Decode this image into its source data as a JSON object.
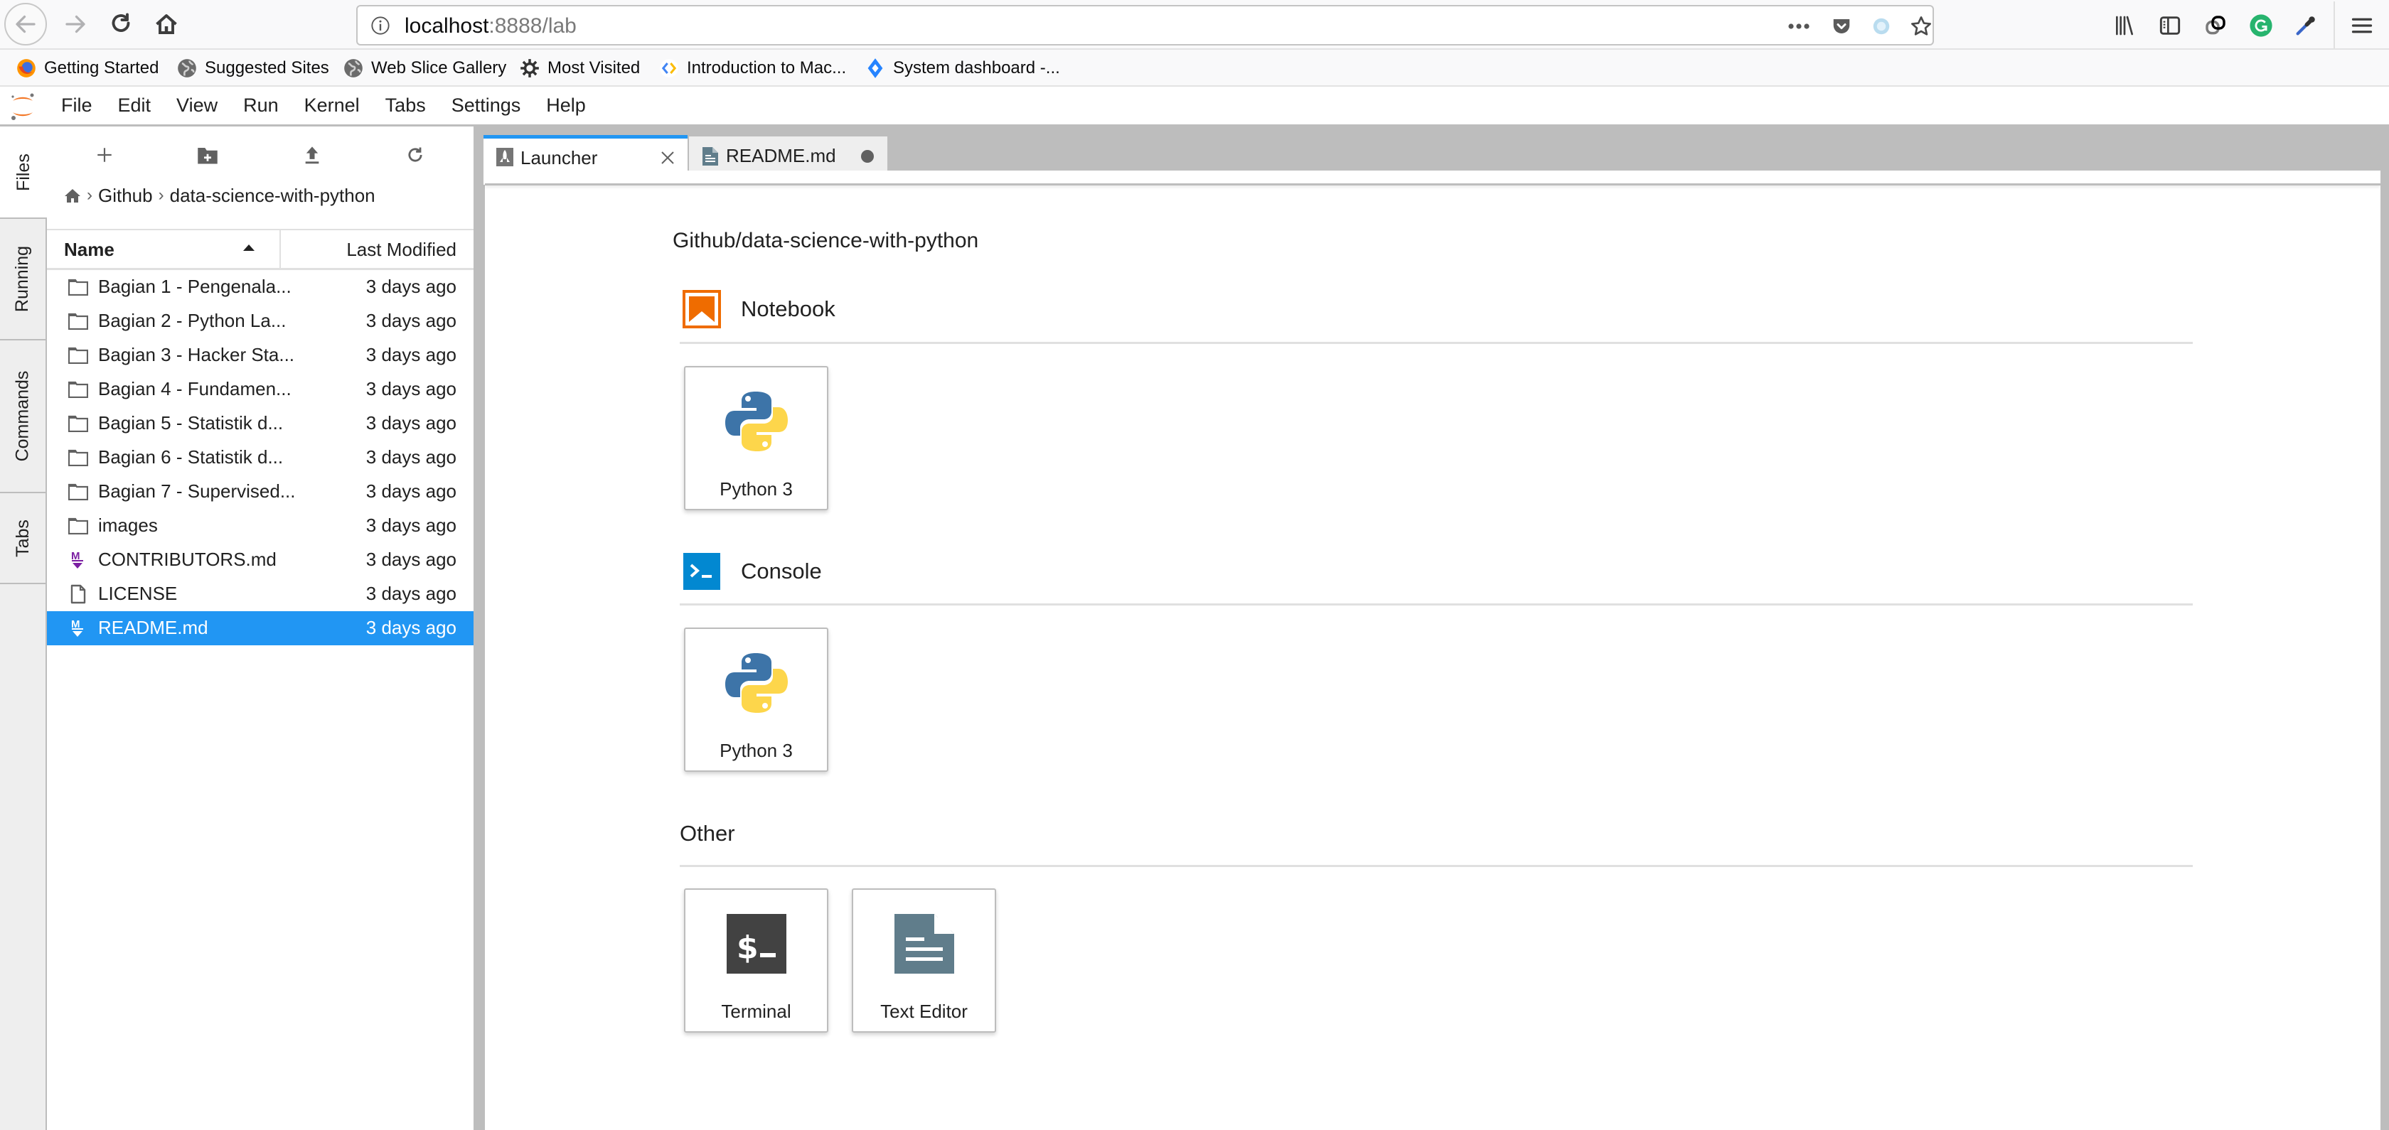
{
  "browser": {
    "url_host": "localhost",
    "url_rest": ":8888/lab",
    "nav": {
      "back": "back-icon",
      "forward": "forward-icon",
      "reload": "reload-icon",
      "home": "home-icon"
    },
    "url_icons": [
      "page-actions-icon",
      "pocket-icon",
      "extension-icon",
      "bookmark-star-icon"
    ],
    "toolbar_icons": [
      "library-icon",
      "sidebar-icon",
      "extension-link-icon",
      "grammarly-icon",
      "eyedropper-icon",
      "hamburger-menu-icon"
    ],
    "bookmarks": [
      {
        "label": "Getting Started",
        "icon": "firefox-icon"
      },
      {
        "label": "Suggested Sites",
        "icon": "globe-icon"
      },
      {
        "label": "Web Slice Gallery",
        "icon": "globe-icon"
      },
      {
        "label": "Most Visited",
        "icon": "gear-icon"
      },
      {
        "label": "Introduction to Mac...",
        "icon": "google-dev-icon"
      },
      {
        "label": "System dashboard -...",
        "icon": "jira-icon"
      }
    ]
  },
  "jupyter": {
    "menu": [
      "File",
      "Edit",
      "View",
      "Run",
      "Kernel",
      "Tabs",
      "Settings",
      "Help"
    ],
    "side_tabs": [
      "Files",
      "Running",
      "Commands",
      "Tabs"
    ],
    "filebrowser": {
      "toolbar": [
        "new-launcher-icon",
        "new-folder-icon",
        "upload-icon",
        "refresh-icon"
      ],
      "breadcrumbs": [
        "Github",
        "data-science-with-python"
      ],
      "header_name": "Name",
      "header_modified": "Last Modified",
      "files": [
        {
          "name": "Bagian 1 - Pengenala...",
          "modified": "3 days ago",
          "type": "folder"
        },
        {
          "name": "Bagian 2 - Python La...",
          "modified": "3 days ago",
          "type": "folder"
        },
        {
          "name": "Bagian 3 - Hacker Sta...",
          "modified": "3 days ago",
          "type": "folder"
        },
        {
          "name": "Bagian 4 - Fundamen...",
          "modified": "3 days ago",
          "type": "folder"
        },
        {
          "name": "Bagian 5 - Statistik d...",
          "modified": "3 days ago",
          "type": "folder"
        },
        {
          "name": "Bagian 6 - Statistik d...",
          "modified": "3 days ago",
          "type": "folder"
        },
        {
          "name": "Bagian 7 - Supervised...",
          "modified": "3 days ago",
          "type": "folder"
        },
        {
          "name": "images",
          "modified": "3 days ago",
          "type": "folder"
        },
        {
          "name": "CONTRIBUTORS.md",
          "modified": "3 days ago",
          "type": "markdown"
        },
        {
          "name": "LICENSE",
          "modified": "3 days ago",
          "type": "file"
        },
        {
          "name": "README.md",
          "modified": "3 days ago",
          "type": "markdown",
          "selected": true
        }
      ]
    },
    "tabs": [
      {
        "label": "Launcher",
        "icon": "launcher-rocket-icon",
        "active": true,
        "close": "close-icon"
      },
      {
        "label": "README.md",
        "icon": "text-file-icon",
        "active": false,
        "close": "unsaved-dot-icon"
      }
    ],
    "launcher": {
      "cwd": "Github/data-science-with-python",
      "sections": [
        {
          "title": "Notebook",
          "icon": "notebook-icon",
          "cards": [
            {
              "label": "Python 3",
              "icon": "python-logo-icon"
            }
          ]
        },
        {
          "title": "Console",
          "icon": "console-icon",
          "cards": [
            {
              "label": "Python 3",
              "icon": "python-logo-icon"
            }
          ]
        },
        {
          "title": "Other",
          "icon": null,
          "cards": [
            {
              "label": "Terminal",
              "icon": "terminal-icon"
            },
            {
              "label": "Text Editor",
              "icon": "text-editor-icon"
            }
          ]
        }
      ]
    },
    "colors": {
      "accent": "#2196f3",
      "notebook_orange": "#ef6c00",
      "console_blue": "#0288d1",
      "markdown_purple": "#7b1fa2",
      "terminal_dark": "#424242",
      "text_editor_slate": "#607d8b"
    }
  }
}
